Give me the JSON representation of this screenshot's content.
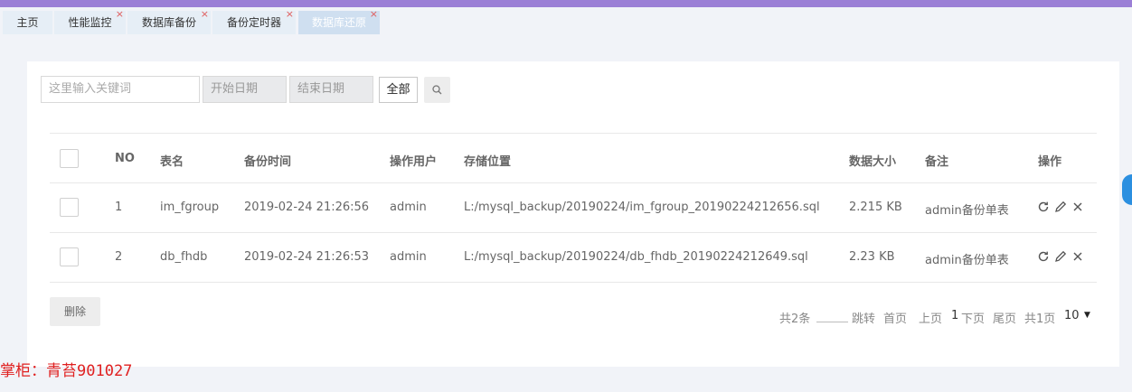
{
  "tabs": [
    {
      "label": "主页",
      "closable": false,
      "active": false
    },
    {
      "label": "性能监控",
      "closable": true,
      "active": false
    },
    {
      "label": "数据库备份",
      "closable": true,
      "active": false
    },
    {
      "label": "备份定时器",
      "closable": true,
      "active": false
    },
    {
      "label": "数据库还原",
      "closable": true,
      "active": true
    }
  ],
  "tab_close_symbol": "×",
  "search": {
    "keyword_placeholder": "这里输入关键词",
    "start_date_placeholder": "开始日期",
    "end_date_placeholder": "结束日期",
    "filter_label": "全部",
    "search_icon": "search-icon"
  },
  "table": {
    "headers": {
      "no": "NO",
      "table_name": "表名",
      "backup_time": "备份时间",
      "operator": "操作用户",
      "storage": "存储位置",
      "size": "数据大小",
      "remark": "备注",
      "actions": "操作"
    },
    "rows": [
      {
        "no": "1",
        "table_name": "im_fgroup",
        "backup_time": "2019-02-24 21:26:56",
        "operator": "admin",
        "storage": "L:/mysql_backup/20190224/im_fgroup_20190224212656.sql",
        "size": "2.215 KB",
        "remark": "admin备份单表"
      },
      {
        "no": "2",
        "table_name": "db_fhdb",
        "backup_time": "2019-02-24 21:26:53",
        "operator": "admin",
        "storage": "L:/mysql_backup/20190224/db_fhdb_20190224212649.sql",
        "size": "2.23 KB",
        "remark": "admin备份单表"
      }
    ],
    "row_action_icons": [
      "refresh-icon",
      "edit-icon",
      "close-icon"
    ]
  },
  "delete_label": "删除",
  "pagination": {
    "total": "共2条",
    "jump": "跳转",
    "first": "首页",
    "prev": "上页",
    "current": "1",
    "next": "下页",
    "last": "尾页",
    "pages": "共1页",
    "page_size": "10"
  },
  "watermark": "掌柜：青苔901027",
  "colors": {
    "accent_bar": "#9b7fd6",
    "tab_bg": "#e6eef6",
    "tab_active_bg": "#cfdff0",
    "tab_close": "#e05a5a",
    "watermark": "#e02020",
    "side_button": "#2b8fe0"
  }
}
